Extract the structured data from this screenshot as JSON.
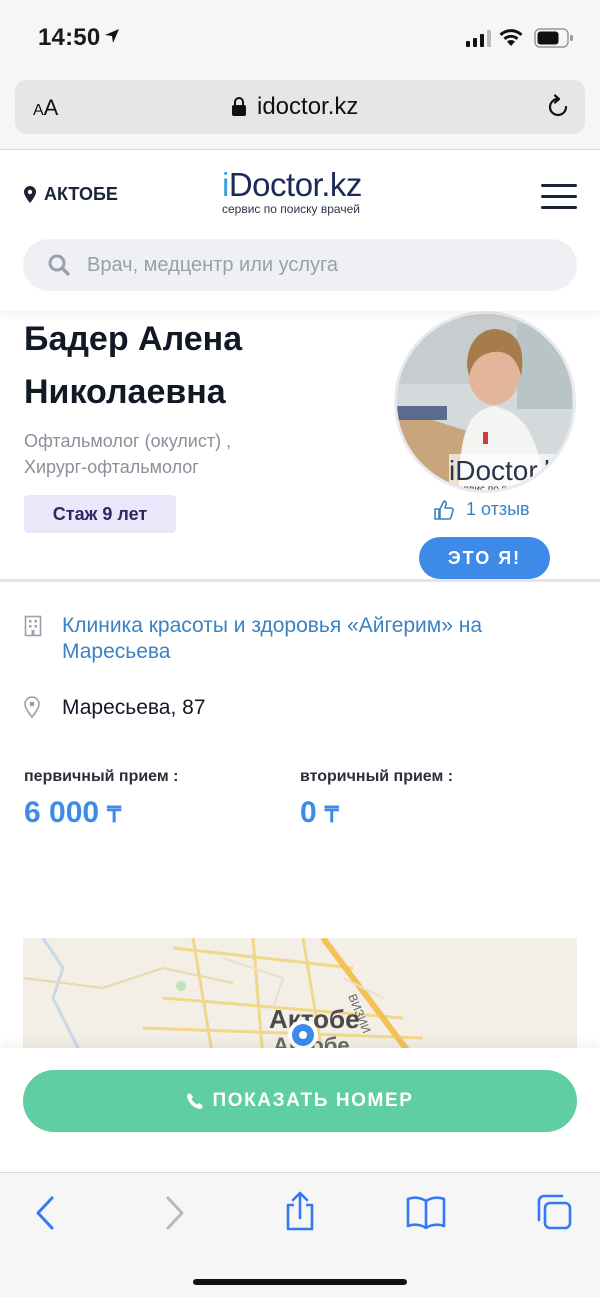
{
  "status_bar": {
    "time": "14:50"
  },
  "browser": {
    "text_size_label_small": "A",
    "text_size_label_large": "A",
    "domain": "idoctor.kz"
  },
  "header": {
    "city": "АКТОБЕ",
    "logo_brand_prefix": "i",
    "logo_brand_rest": "Doctor.kz",
    "logo_slogan": "сервис по поиску врачей",
    "search_placeholder": "Врач, медцентр или услуга"
  },
  "doctor": {
    "name": "Бадер Алена Николаевна",
    "specialty_line1": "Офтальмолог (окулист) ,",
    "specialty_line2": "Хирург-офтальмолог",
    "experience": "Стаж 9 лет",
    "reviews": "1 отзыв",
    "claim_button": "ЭТО Я!",
    "photo_watermark": "iDoctor.k",
    "photo_watermark_sub": "сервис по поис"
  },
  "clinic": {
    "name": "Клиника красоты и здоровья «Айгерим» на Маресьева",
    "address": "Маресьева, 87"
  },
  "prices": {
    "primary_label": "первичный прием :",
    "primary_value": "6 000",
    "secondary_label": "вторичный прием :",
    "secondary_value": "0",
    "currency": "₸"
  },
  "map": {
    "city_label_1": "Актобе",
    "city_label_2": "Актобе",
    "street_label": "ВИЗИИ"
  },
  "actions": {
    "show_number": "ПОКАЗАТЬ НОМЕР"
  },
  "colors": {
    "accent_blue": "#3d8ae8",
    "link_blue": "#3b82c4",
    "green": "#5fcea2",
    "badge_purple": "#ece6fb"
  }
}
